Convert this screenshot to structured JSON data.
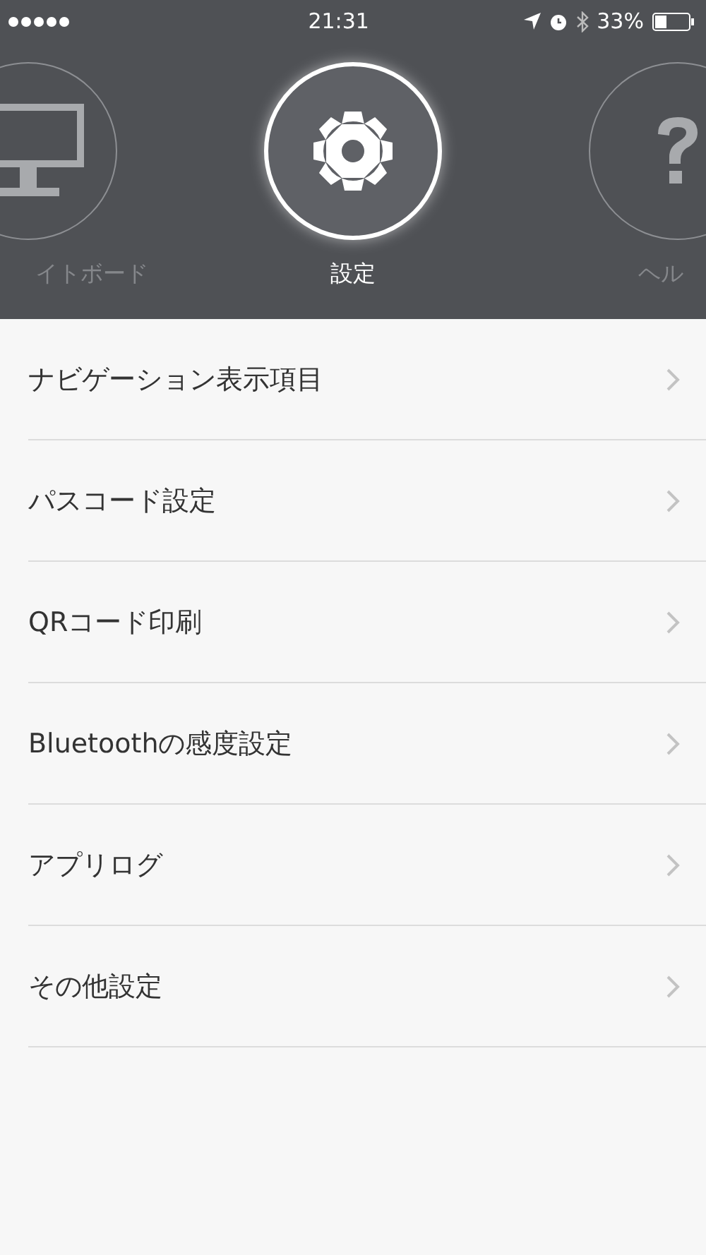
{
  "status_bar": {
    "time": "21:31",
    "battery_percent": "33%"
  },
  "carousel": [
    {
      "label": "イトボード",
      "selected": false,
      "kind": "monitor"
    },
    {
      "label": "設定",
      "selected": true,
      "kind": "gear"
    },
    {
      "label": "ヘル",
      "selected": false,
      "kind": "help"
    }
  ],
  "menu_items": [
    {
      "label": "ナビゲーション表示項目"
    },
    {
      "label": "パスコード設定"
    },
    {
      "label": "QRコード印刷"
    },
    {
      "label": "Bluetoothの感度設定"
    },
    {
      "label": "アプリログ"
    },
    {
      "label": "その他設定"
    }
  ]
}
